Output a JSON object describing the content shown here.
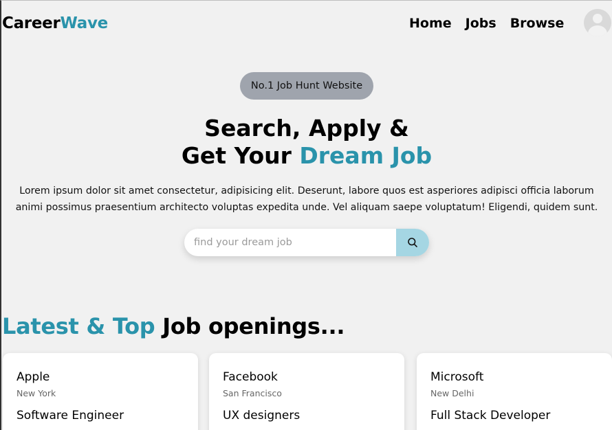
{
  "nav": {
    "logo_primary": "Career",
    "logo_accent": "Wave",
    "links": [
      {
        "label": "Home"
      },
      {
        "label": "Jobs"
      },
      {
        "label": "Browse"
      }
    ],
    "avatar_icon": "user-avatar-icon"
  },
  "hero": {
    "badge": "No.1 Job Hunt Website",
    "title_line1": "Search, Apply &",
    "title_line2_plain": "Get Your ",
    "title_line2_accent": "Dream Job",
    "description": "Lorem ipsum dolor sit amet consectetur, adipisicing elit. Deserunt, labore quos est asperiores adipisci officia laborum animi possimus praesentium architecto voluptas expedita unde. Vel aliquam saepe voluptatum! Eligendi, quidem sunt.",
    "search_placeholder": "find your dream job",
    "search_value": "",
    "search_icon": "search-icon"
  },
  "section": {
    "title_accent": "Latest & Top",
    "title_plain": " Job openings..."
  },
  "jobs": [
    {
      "company": "Apple",
      "location": "New York",
      "role": "Software Engineer"
    },
    {
      "company": "Facebook",
      "location": "San Francisco",
      "role": "UX designers"
    },
    {
      "company": "Microsoft",
      "location": "New Delhi",
      "role": "Full Stack Developer"
    }
  ],
  "colors": {
    "accent": "#2a93ab",
    "background": "#f1f1f1",
    "badge": "#9fa4ad",
    "search_button": "#a5d6e3"
  }
}
